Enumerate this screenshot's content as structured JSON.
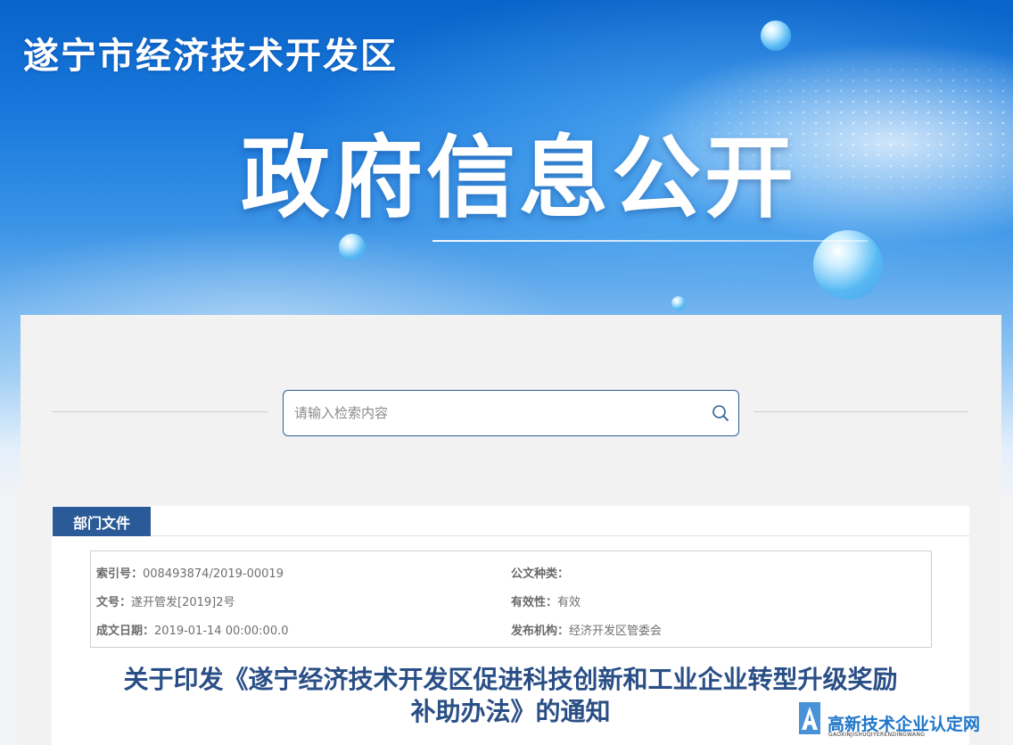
{
  "header": {
    "site_title": "遂宁市经济技术开发区",
    "banner_title": "政府信息公开"
  },
  "search": {
    "placeholder": "请输入检索内容",
    "value": "",
    "icon": "search-icon"
  },
  "section": {
    "tab_label": "部门文件"
  },
  "meta": {
    "index_label": "索引号：",
    "index_value": "008493874/2019-00019",
    "doc_type_label": "公文种类：",
    "doc_type_value": "",
    "doc_no_label": "文号：",
    "doc_no_value": "遂开管发[2019]2号",
    "validity_label": "有效性：",
    "validity_value": "有效",
    "date_label": "成文日期：",
    "date_value": "2019-01-14 00:00:00.0",
    "issuer_label": "发布机构：",
    "issuer_value": "经济开发区管委会"
  },
  "article": {
    "title_line1": "关于印发《遂宁经济技术开发区促进科技创新和工业企业转型升级奖励",
    "title_line2": "补助办法》的通知"
  },
  "watermark": {
    "name": "高新技术企业认定网",
    "pinyin": "GAOXINJISHUQIYERENDINGWANG"
  },
  "colors": {
    "accent": "#2a5a97",
    "title_blue": "#2a4f86",
    "banner_blue": "#1878dc"
  }
}
